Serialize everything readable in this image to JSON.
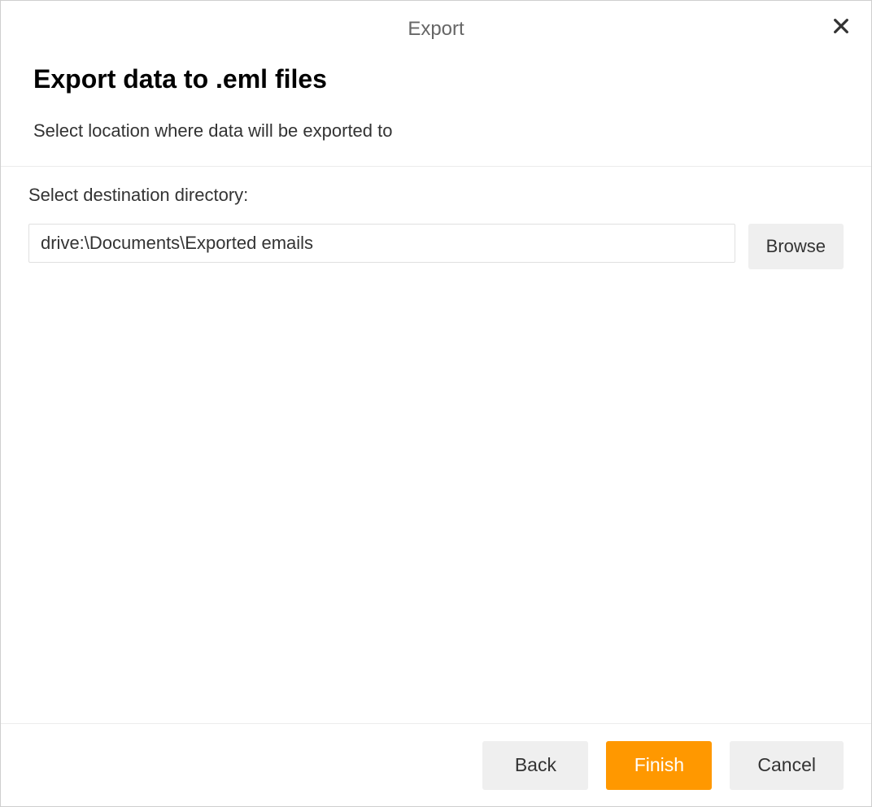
{
  "dialog": {
    "title": "Export"
  },
  "header": {
    "heading": "Export data to .eml files",
    "subtitle": "Select location where data will be exported to"
  },
  "content": {
    "field_label": "Select destination directory:",
    "path_value": "drive:\\Documents\\Exported emails",
    "browse_label": "Browse"
  },
  "footer": {
    "back_label": "Back",
    "finish_label": "Finish",
    "cancel_label": "Cancel"
  }
}
